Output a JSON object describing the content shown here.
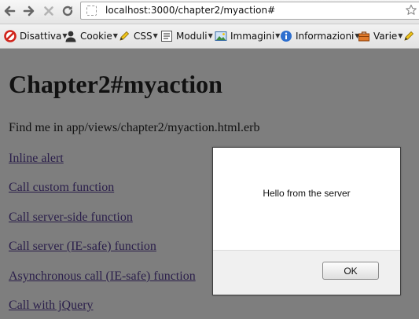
{
  "browser": {
    "url": "localhost:3000/chapter2/myaction#"
  },
  "bookmarks": [
    {
      "label": "Disattiva",
      "icon": "disable-icon",
      "has_menu": true
    },
    {
      "label": "Cookie",
      "icon": "person-icon",
      "has_menu": true
    },
    {
      "label": "CSS",
      "icon": "pencil-icon",
      "has_menu": true
    },
    {
      "label": "Moduli",
      "icon": "form-icon",
      "has_menu": true
    },
    {
      "label": "Immagini",
      "icon": "image-icon",
      "has_menu": true
    },
    {
      "label": "Informazioni",
      "icon": "info-icon",
      "has_menu": true
    },
    {
      "label": "Varie",
      "icon": "toolbox-icon",
      "has_menu": true
    }
  ],
  "page": {
    "title": "Chapter2#myaction",
    "note": "Find me in app/views/chapter2/myaction.html.erb",
    "links": [
      "Inline alert",
      "Call custom function",
      "Call server-side function",
      "Call server (IE-safe) function",
      "Asynchronous call (IE-safe) function",
      "Call with jQuery"
    ]
  },
  "dialog": {
    "message": "Hello from the server",
    "ok_label": "OK"
  },
  "colors": {
    "overlay": "#7e7e7e",
    "link": "#2a1e4a"
  }
}
